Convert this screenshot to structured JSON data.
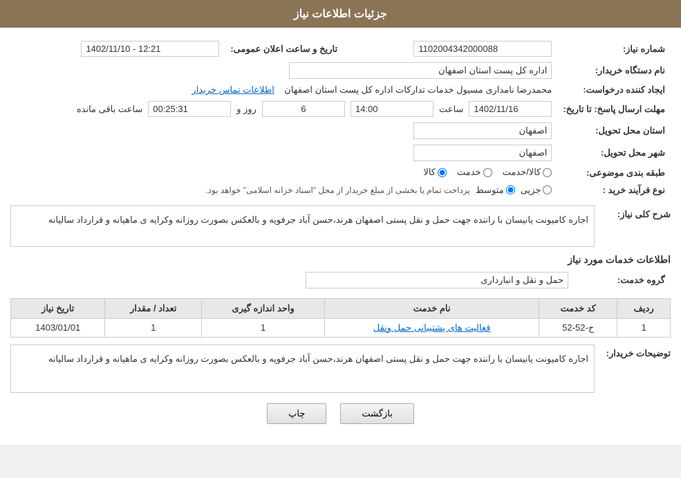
{
  "header": {
    "title": "جزئیات اطلاعات نیاز"
  },
  "labels": {
    "need_number": "شماره نیاز:",
    "buyer_org": "نام دستگاه خریدار:",
    "creator": "ایجاد کننده درخواست:",
    "deadline": "مهلت ارسال پاسخ: تا تاریخ:",
    "province": "استان محل تحویل:",
    "city": "شهر محل تحویل:",
    "category": "طبقه بندی موضوعی:",
    "process_type": "نوع فرآیند خرید :",
    "need_description": "شرح کلی نیاز:",
    "service_info": "اطلاعات خدمات مورد نیاز",
    "service_group": "گروه خدمت:",
    "buyer_notes": "توضیحات خریدار:",
    "announcement_date": "تاریخ و ساعت اعلان عمومی:",
    "contact": "اطلاعات تماس خریدار"
  },
  "values": {
    "need_number": "1102004342000088",
    "buyer_org": "اداره کل پست استان اصفهان",
    "creator": "محمدرضا نامداری مسیول خدمات تدارکات اداره کل پست استان اصفهان",
    "announcement_date": "1402/11/10 - 12:21",
    "deadline_date": "1402/11/16",
    "deadline_time": "14:00",
    "deadline_days": "6",
    "deadline_remaining": "00:25:31",
    "province": "اصفهان",
    "city": "اصفهان",
    "category_goods": "کالا",
    "category_service": "خدمت",
    "category_goods_service": "کالا/خدمت",
    "process_part": "جزیی",
    "process_medium": "متوسط",
    "process_note": "پرداخت تمام یا بخشی از مبلغ خریدار از محل \"اسناد خزانه اسلامی\" خواهد بود.",
    "need_description_text": "اجاره کامیونت یانیسان با راننده جهت حمل و نقل پستی  اصفهان هرند،حسن آباد جرفویه و بالعکس بصورت روزانه وکرایه ی ماهیانه و قرارداد سالیانه",
    "service_group_value": "حمل و نقل و انبارداری",
    "buyer_notes_text": "اجاره کامیونت یانیسان با راننده جهت حمل و نقل پستی  اصفهان هرند،حسن آباد جرفویه و بالعکس بصورت روزانه وکرایه ی ماهیانه و قرارداد سالیانه",
    "days_label": "روز و",
    "hours_label": "ساعت باقی مانده"
  },
  "service_table": {
    "columns": [
      "ردیف",
      "کد خدمت",
      "نام خدمت",
      "واحد اندازه گیری",
      "تعداد / مقدار",
      "تاریخ نیاز"
    ],
    "rows": [
      {
        "index": "1",
        "code": "ح-52-52",
        "name": "فعالیت های پشتیبانی حمل ونقل",
        "unit": "1",
        "quantity": "1",
        "date": "1403/01/01"
      }
    ]
  },
  "buttons": {
    "print": "چاپ",
    "back": "بازگشت"
  }
}
